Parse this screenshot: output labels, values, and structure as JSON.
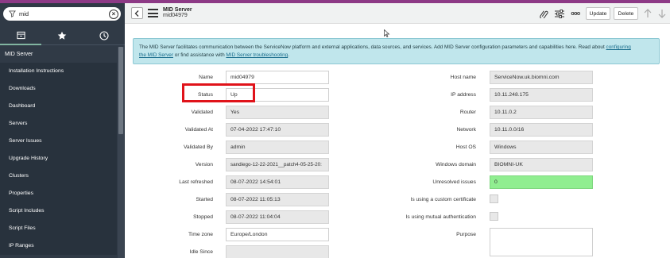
{
  "sidebar": {
    "filter_value": "mid",
    "section_title": "MID Server",
    "items": [
      {
        "label": "Installation Instructions"
      },
      {
        "label": "Downloads"
      },
      {
        "label": "Dashboard"
      },
      {
        "label": "Servers"
      },
      {
        "label": "Server Issues"
      },
      {
        "label": "Upgrade History"
      },
      {
        "label": "Clusters"
      },
      {
        "label": "Properties"
      },
      {
        "label": "Script Includes"
      },
      {
        "label": "Script Files"
      },
      {
        "label": "IP Ranges"
      }
    ]
  },
  "header": {
    "title": "MID Server",
    "subtitle": "mid04979",
    "more_label": "ooo",
    "update_label": "Update",
    "delete_label": "Delete"
  },
  "banner": {
    "text1": "The MID Server facilitates communication between the ServiceNow platform and external applications, data sources, and services. Add MID Server configuration parameters and capabilities here. Read about ",
    "link1a": "configuring",
    "link1b": "the MID Server",
    "text2": " or find assistance with ",
    "link2": "MID Server troubleshooting",
    "text3": "."
  },
  "form": {
    "left": [
      {
        "label": "Name",
        "value": "mid04979"
      },
      {
        "label": "Status",
        "value": "Up"
      },
      {
        "label": "Validated",
        "value": "Yes"
      },
      {
        "label": "Validated At",
        "value": "07-04-2022 17:47:10"
      },
      {
        "label": "Validated By",
        "value": "admin"
      },
      {
        "label": "Version",
        "value": "sandiego-12-22-2021__patch4-05-25-20:"
      },
      {
        "label": "Last refreshed",
        "value": "08-07-2022 14:54:01"
      },
      {
        "label": "Started",
        "value": "08-07-2022 11:05:13"
      },
      {
        "label": "Stopped",
        "value": "08-07-2022 11:04:04"
      },
      {
        "label": "Time zone",
        "value": "Europe/London"
      },
      {
        "label": "Idle Since",
        "value": ""
      }
    ],
    "right": [
      {
        "label": "Host name",
        "value": "ServiceNow.uk.biomni.com"
      },
      {
        "label": "IP address",
        "value": "10.11.248.175"
      },
      {
        "label": "Router",
        "value": "10.11.0.2"
      },
      {
        "label": "Network",
        "value": "10.11.0.0/16"
      },
      {
        "label": "Host OS",
        "value": "Windows"
      },
      {
        "label": "Windows domain",
        "value": "BIOMNI-UK"
      },
      {
        "label": "Unresolved issues",
        "value": "0"
      },
      {
        "label": "Is using a custom certificate",
        "value": ""
      },
      {
        "label": "Is using mutual authentication",
        "value": ""
      },
      {
        "label": "Purpose",
        "value": ""
      }
    ]
  },
  "colors": {
    "sidebar_bg": "#303a46",
    "accent_strip": "#8d3a86",
    "banner_bg": "#c0e6ec",
    "unresolved_ok": "#90ee90",
    "highlight": "#e0131a"
  }
}
